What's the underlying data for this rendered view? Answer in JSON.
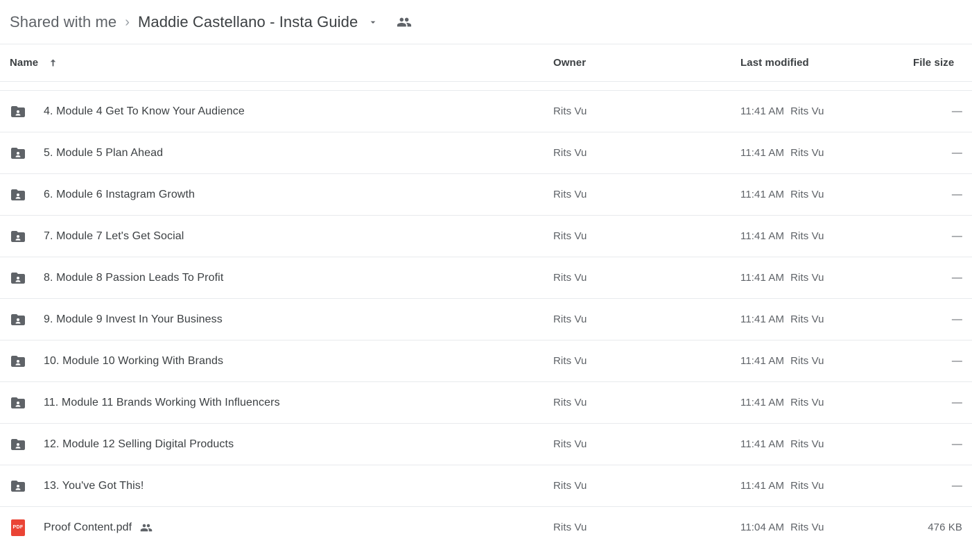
{
  "breadcrumb": {
    "parent": "Shared with me",
    "separator": "›",
    "current": "Maddie Castellano - Insta Guide",
    "chevron_icon": "chevron-down-icon",
    "shared_icon": "people-shared-icon"
  },
  "columns": {
    "name": "Name",
    "owner": "Owner",
    "last_modified": "Last modified",
    "file_size": "File size",
    "sort_icon": "arrow-up-icon",
    "sort_direction": "ascending"
  },
  "colors": {
    "folder_icon": "#5f6368",
    "pdf_icon": "#ea4435",
    "primary_text": "#3c4043",
    "secondary_text": "#5f6368",
    "divider": "#e8eaed"
  },
  "rows": [
    {
      "icon": "shared-folder-icon",
      "type": "folder",
      "name": "4. Module 4 Get To Know Your Audience",
      "shared": false,
      "owner": "Rits Vu",
      "modified_time": "11:41 AM",
      "modified_by": "Rits Vu",
      "size": "—"
    },
    {
      "icon": "shared-folder-icon",
      "type": "folder",
      "name": "5. Module 5 Plan Ahead",
      "shared": false,
      "owner": "Rits Vu",
      "modified_time": "11:41 AM",
      "modified_by": "Rits Vu",
      "size": "—"
    },
    {
      "icon": "shared-folder-icon",
      "type": "folder",
      "name": "6. Module 6 Instagram Growth",
      "shared": false,
      "owner": "Rits Vu",
      "modified_time": "11:41 AM",
      "modified_by": "Rits Vu",
      "size": "—"
    },
    {
      "icon": "shared-folder-icon",
      "type": "folder",
      "name": "7. Module 7 Let's Get Social",
      "shared": false,
      "owner": "Rits Vu",
      "modified_time": "11:41 AM",
      "modified_by": "Rits Vu",
      "size": "—"
    },
    {
      "icon": "shared-folder-icon",
      "type": "folder",
      "name": "8. Module 8 Passion Leads To Profit",
      "shared": false,
      "owner": "Rits Vu",
      "modified_time": "11:41 AM",
      "modified_by": "Rits Vu",
      "size": "—"
    },
    {
      "icon": "shared-folder-icon",
      "type": "folder",
      "name": "9. Module 9 Invest In Your Business",
      "shared": false,
      "owner": "Rits Vu",
      "modified_time": "11:41 AM",
      "modified_by": "Rits Vu",
      "size": "—"
    },
    {
      "icon": "shared-folder-icon",
      "type": "folder",
      "name": "10. Module 10 Working With Brands",
      "shared": false,
      "owner": "Rits Vu",
      "modified_time": "11:41 AM",
      "modified_by": "Rits Vu",
      "size": "—"
    },
    {
      "icon": "shared-folder-icon",
      "type": "folder",
      "name": "11. Module 11 Brands Working With Influencers",
      "shared": false,
      "owner": "Rits Vu",
      "modified_time": "11:41 AM",
      "modified_by": "Rits Vu",
      "size": "—"
    },
    {
      "icon": "shared-folder-icon",
      "type": "folder",
      "name": "12. Module 12 Selling Digital Products",
      "shared": false,
      "owner": "Rits Vu",
      "modified_time": "11:41 AM",
      "modified_by": "Rits Vu",
      "size": "—"
    },
    {
      "icon": "shared-folder-icon",
      "type": "folder",
      "name": "13. You've Got This!",
      "shared": false,
      "owner": "Rits Vu",
      "modified_time": "11:41 AM",
      "modified_by": "Rits Vu",
      "size": "—"
    },
    {
      "icon": "pdf-file-icon",
      "type": "pdf",
      "icon_label": "PDF",
      "name": "Proof Content.pdf",
      "shared": true,
      "owner": "Rits Vu",
      "modified_time": "11:04 AM",
      "modified_by": "Rits Vu",
      "size": "476 KB"
    }
  ]
}
